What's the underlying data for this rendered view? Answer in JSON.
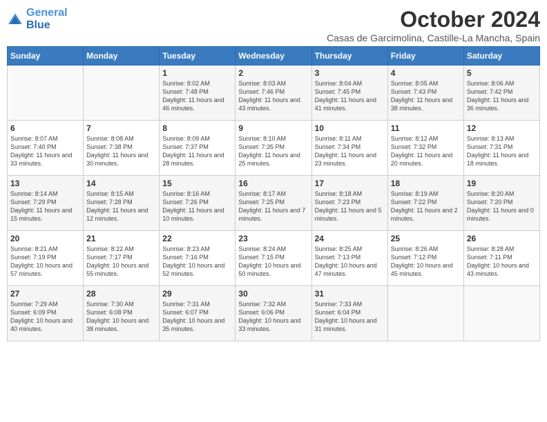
{
  "header": {
    "logo_line1": "General",
    "logo_line2": "Blue",
    "month": "October 2024",
    "location": "Casas de Garcimolina, Castille-La Mancha, Spain"
  },
  "weekdays": [
    "Sunday",
    "Monday",
    "Tuesday",
    "Wednesday",
    "Thursday",
    "Friday",
    "Saturday"
  ],
  "weeks": [
    [
      {
        "day": "",
        "info": ""
      },
      {
        "day": "",
        "info": ""
      },
      {
        "day": "1",
        "info": "Sunrise: 8:02 AM\nSunset: 7:48 PM\nDaylight: 11 hours and 46 minutes."
      },
      {
        "day": "2",
        "info": "Sunrise: 8:03 AM\nSunset: 7:46 PM\nDaylight: 11 hours and 43 minutes."
      },
      {
        "day": "3",
        "info": "Sunrise: 8:04 AM\nSunset: 7:45 PM\nDaylight: 11 hours and 41 minutes."
      },
      {
        "day": "4",
        "info": "Sunrise: 8:05 AM\nSunset: 7:43 PM\nDaylight: 11 hours and 38 minutes."
      },
      {
        "day": "5",
        "info": "Sunrise: 8:06 AM\nSunset: 7:42 PM\nDaylight: 11 hours and 36 minutes."
      }
    ],
    [
      {
        "day": "6",
        "info": "Sunrise: 8:07 AM\nSunset: 7:40 PM\nDaylight: 11 hours and 33 minutes."
      },
      {
        "day": "7",
        "info": "Sunrise: 8:08 AM\nSunset: 7:38 PM\nDaylight: 11 hours and 30 minutes."
      },
      {
        "day": "8",
        "info": "Sunrise: 8:09 AM\nSunset: 7:37 PM\nDaylight: 11 hours and 28 minutes."
      },
      {
        "day": "9",
        "info": "Sunrise: 8:10 AM\nSunset: 7:35 PM\nDaylight: 11 hours and 25 minutes."
      },
      {
        "day": "10",
        "info": "Sunrise: 8:11 AM\nSunset: 7:34 PM\nDaylight: 11 hours and 23 minutes."
      },
      {
        "day": "11",
        "info": "Sunrise: 8:12 AM\nSunset: 7:32 PM\nDaylight: 11 hours and 20 minutes."
      },
      {
        "day": "12",
        "info": "Sunrise: 8:13 AM\nSunset: 7:31 PM\nDaylight: 11 hours and 18 minutes."
      }
    ],
    [
      {
        "day": "13",
        "info": "Sunrise: 8:14 AM\nSunset: 7:29 PM\nDaylight: 11 hours and 15 minutes."
      },
      {
        "day": "14",
        "info": "Sunrise: 8:15 AM\nSunset: 7:28 PM\nDaylight: 11 hours and 12 minutes."
      },
      {
        "day": "15",
        "info": "Sunrise: 8:16 AM\nSunset: 7:26 PM\nDaylight: 11 hours and 10 minutes."
      },
      {
        "day": "16",
        "info": "Sunrise: 8:17 AM\nSunset: 7:25 PM\nDaylight: 11 hours and 7 minutes."
      },
      {
        "day": "17",
        "info": "Sunrise: 8:18 AM\nSunset: 7:23 PM\nDaylight: 11 hours and 5 minutes."
      },
      {
        "day": "18",
        "info": "Sunrise: 8:19 AM\nSunset: 7:22 PM\nDaylight: 11 hours and 2 minutes."
      },
      {
        "day": "19",
        "info": "Sunrise: 8:20 AM\nSunset: 7:20 PM\nDaylight: 11 hours and 0 minutes."
      }
    ],
    [
      {
        "day": "20",
        "info": "Sunrise: 8:21 AM\nSunset: 7:19 PM\nDaylight: 10 hours and 57 minutes."
      },
      {
        "day": "21",
        "info": "Sunrise: 8:22 AM\nSunset: 7:17 PM\nDaylight: 10 hours and 55 minutes."
      },
      {
        "day": "22",
        "info": "Sunrise: 8:23 AM\nSunset: 7:16 PM\nDaylight: 10 hours and 52 minutes."
      },
      {
        "day": "23",
        "info": "Sunrise: 8:24 AM\nSunset: 7:15 PM\nDaylight: 10 hours and 50 minutes."
      },
      {
        "day": "24",
        "info": "Sunrise: 8:25 AM\nSunset: 7:13 PM\nDaylight: 10 hours and 47 minutes."
      },
      {
        "day": "25",
        "info": "Sunrise: 8:26 AM\nSunset: 7:12 PM\nDaylight: 10 hours and 45 minutes."
      },
      {
        "day": "26",
        "info": "Sunrise: 8:28 AM\nSunset: 7:11 PM\nDaylight: 10 hours and 43 minutes."
      }
    ],
    [
      {
        "day": "27",
        "info": "Sunrise: 7:29 AM\nSunset: 6:09 PM\nDaylight: 10 hours and 40 minutes."
      },
      {
        "day": "28",
        "info": "Sunrise: 7:30 AM\nSunset: 6:08 PM\nDaylight: 10 hours and 38 minutes."
      },
      {
        "day": "29",
        "info": "Sunrise: 7:31 AM\nSunset: 6:07 PM\nDaylight: 10 hours and 35 minutes."
      },
      {
        "day": "30",
        "info": "Sunrise: 7:32 AM\nSunset: 6:06 PM\nDaylight: 10 hours and 33 minutes."
      },
      {
        "day": "31",
        "info": "Sunrise: 7:33 AM\nSunset: 6:04 PM\nDaylight: 10 hours and 31 minutes."
      },
      {
        "day": "",
        "info": ""
      },
      {
        "day": "",
        "info": ""
      }
    ]
  ]
}
